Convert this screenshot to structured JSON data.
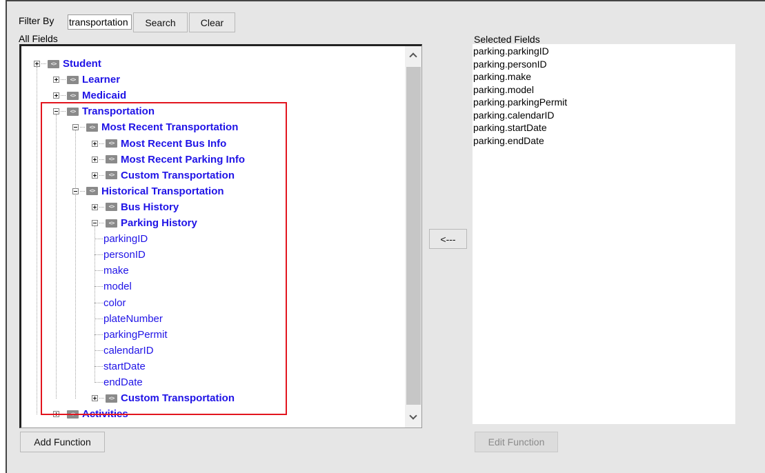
{
  "filter": {
    "label": "Filter By",
    "value": "transportation",
    "search_label": "Search",
    "clear_label": "Clear"
  },
  "all_fields_label": "All Fields",
  "selected_fields_label": "Selected Fields",
  "move_left_label": "<---",
  "add_function_label": "Add Function",
  "edit_function_label": "Edit Function",
  "tree": [
    {
      "label": "Student",
      "type": "node",
      "level": 0,
      "state": "plus"
    },
    {
      "label": "Learner",
      "type": "node",
      "level": 1,
      "state": "plus"
    },
    {
      "label": "Medicaid",
      "type": "node",
      "level": 1,
      "state": "plus"
    },
    {
      "label": "Transportation",
      "type": "node",
      "level": 1,
      "state": "minus"
    },
    {
      "label": "Most Recent Transportation",
      "type": "node",
      "level": 2,
      "state": "minus"
    },
    {
      "label": "Most Recent Bus Info",
      "type": "node",
      "level": 3,
      "state": "plus"
    },
    {
      "label": "Most Recent Parking Info",
      "type": "node",
      "level": 3,
      "state": "plus"
    },
    {
      "label": "Custom Transportation",
      "type": "node",
      "level": 3,
      "state": "plus"
    },
    {
      "label": "Historical Transportation",
      "type": "node",
      "level": 2,
      "state": "minus"
    },
    {
      "label": "Bus History",
      "type": "node",
      "level": 3,
      "state": "plus"
    },
    {
      "label": "Parking History",
      "type": "node",
      "level": 3,
      "state": "minus"
    },
    {
      "label": "parkingID",
      "type": "leaf",
      "level": 4
    },
    {
      "label": "personID",
      "type": "leaf",
      "level": 4
    },
    {
      "label": "make",
      "type": "leaf",
      "level": 4
    },
    {
      "label": "model",
      "type": "leaf",
      "level": 4
    },
    {
      "label": "color",
      "type": "leaf",
      "level": 4
    },
    {
      "label": "plateNumber",
      "type": "leaf",
      "level": 4
    },
    {
      "label": "parkingPermit",
      "type": "leaf",
      "level": 4
    },
    {
      "label": "calendarID",
      "type": "leaf",
      "level": 4
    },
    {
      "label": "startDate",
      "type": "leaf",
      "level": 4
    },
    {
      "label": "endDate",
      "type": "leaf",
      "level": 4
    },
    {
      "label": "Custom Transportation",
      "type": "node",
      "level": 3,
      "state": "plus"
    },
    {
      "label": "Activities",
      "type": "node",
      "level": 1,
      "state": "plus"
    }
  ],
  "selected_fields": [
    "parking.parkingID",
    "parking.personID",
    "parking.make",
    "parking.model",
    "parking.parkingPermit",
    "parking.calendarID",
    "parking.startDate",
    "parking.endDate"
  ],
  "icons": {
    "node_icon": "xml-tag-icon",
    "node_icon_text": "<>",
    "scroll_up": "chevron-up-icon",
    "scroll_down": "chevron-down-icon"
  },
  "colors": {
    "node_text": "#1f13e6",
    "highlight_border": "#e2141e"
  }
}
